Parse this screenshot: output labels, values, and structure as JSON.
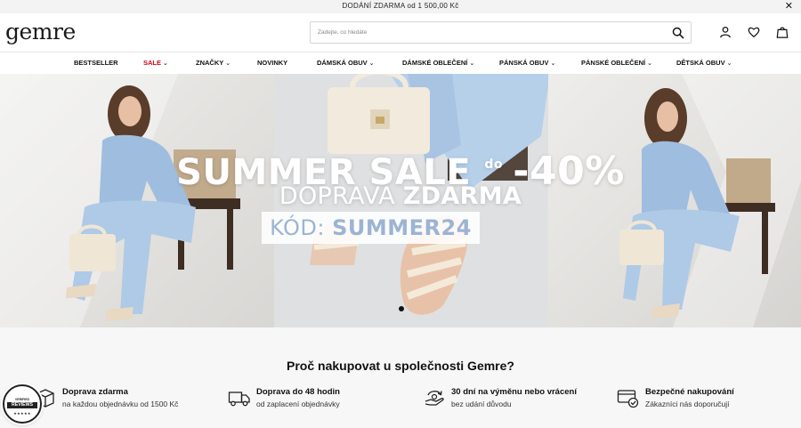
{
  "topbar": {
    "message": "DODÁNÍ ZDARMA od 1 500,00 Kč",
    "close_icon": "close-icon"
  },
  "header": {
    "logo": "gemre",
    "search_placeholder": "Zadejte, co hledáte",
    "icons": [
      "search-icon",
      "user-icon",
      "heart-icon",
      "bag-icon"
    ]
  },
  "nav": {
    "items": [
      {
        "label": "BESTSELLER",
        "dropdown": false
      },
      {
        "label": "SALE",
        "dropdown": true
      },
      {
        "label": "ZNAČKY",
        "dropdown": true
      },
      {
        "label": "NOVINKY",
        "dropdown": false
      },
      {
        "label": "DÁMSKÁ OBUV",
        "dropdown": true
      },
      {
        "label": "DÁMSKÉ OBLEČENÍ",
        "dropdown": true
      },
      {
        "label": "PÁNSKÁ OBUV",
        "dropdown": true
      },
      {
        "label": "PÁNSKÉ OBLEČENÍ",
        "dropdown": true
      },
      {
        "label": "DĚTSKÁ OBUV",
        "dropdown": true
      }
    ],
    "sale_color": "#d0021b",
    "chevron": "⌄"
  },
  "hero": {
    "line1_a": "SUMMER SALE",
    "line1_do": "do",
    "line1_b": "-40%",
    "line2_a": "DOPRAVA",
    "line2_b": "ZDARMA",
    "code_label": "KÓD:",
    "code_value": "SUMMER24",
    "code_color": "#9cb4d4",
    "slide_count": 1,
    "active_slide": 1
  },
  "why": {
    "title": "Proč nakupovat u společnosti Gemre?",
    "features": [
      {
        "title": "Doprava zdarma",
        "subtitle": "na každou objednávku od 1500 Kč",
        "icon": "box-icon"
      },
      {
        "title": "Doprava do 48 hodin",
        "subtitle": "od zaplacení objednávky",
        "icon": "truck-icon"
      },
      {
        "title": "30 dní na výměnu nebo vrácení",
        "subtitle": "bez udání důvodu",
        "icon": "return-icon"
      },
      {
        "title": "Bezpečné nakupování",
        "subtitle": "Zákazníci nás doporučují",
        "icon": "secure-card-icon"
      }
    ]
  },
  "badge": {
    "line1": "VERIFIED",
    "line2": "REVIEWS",
    "stars": "★★★★★"
  }
}
